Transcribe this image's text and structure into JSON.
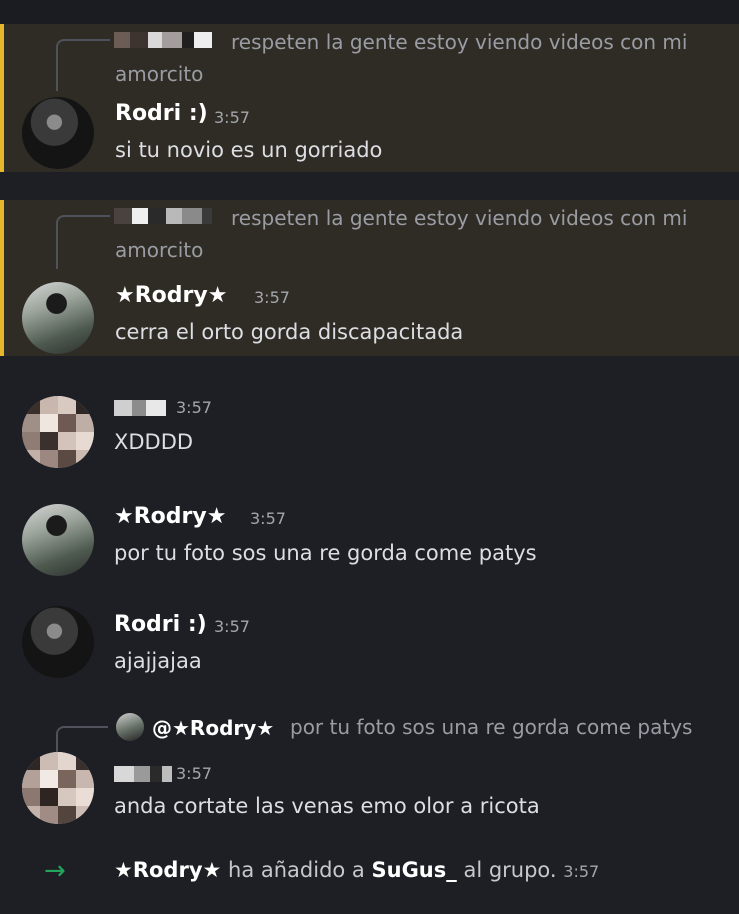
{
  "messages": [
    {
      "reply_text": "respeten la gente estoy viendo videos con mi amorcito",
      "author": "Rodri :)",
      "time": "3:57",
      "text": "si tu novio es un gorriado"
    },
    {
      "reply_text": "respeten la gente estoy viendo videos con mi amorcito",
      "author": "★Rodry★",
      "time": "3:57",
      "text": "cerra el orto gorda discapacitada"
    },
    {
      "author": "",
      "time": "3:57",
      "text": "XDDDD"
    },
    {
      "author": "★Rodry★",
      "time": "3:57",
      "text": "por tu foto sos una re gorda come patys"
    },
    {
      "author": "Rodri :)",
      "time": "3:57",
      "text": "ajajjajaa"
    },
    {
      "reply_author": "@★Rodry★",
      "reply_text": "por tu foto sos una re gorda come patys",
      "author": "",
      "time": "3:57",
      "text": "anda cortate las venas emo olor a ricota"
    }
  ],
  "system": {
    "actor": "★Rodry★",
    "action": "ha añadido a",
    "target": "SuGus_",
    "suffix": "al grupo.",
    "time": "3:57"
  },
  "colors": {
    "background": "#1e1f25",
    "highlight_bg": "#2f2c25",
    "highlight_bar": "#e7b52c",
    "join_arrow": "#23a55a"
  }
}
